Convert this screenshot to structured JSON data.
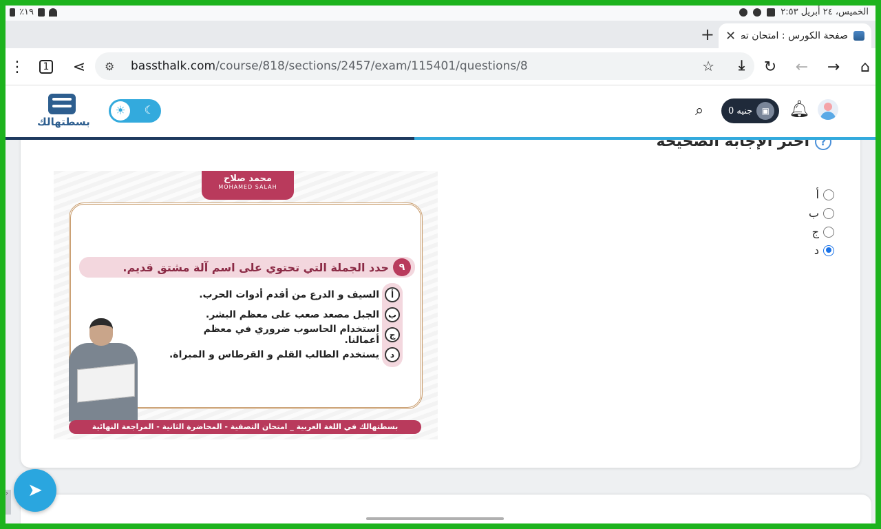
{
  "status_bar": {
    "left_text": "٪١٩",
    "right_text": "الخميس، ٢٤ أبريل  ٢:٥٣"
  },
  "tab": {
    "title": "صفحة الكورس : امتحان تصفية",
    "new_tab": "+",
    "close": "✕"
  },
  "address_bar": {
    "url_host": "bassthalk.com",
    "url_path": "/course/818/sections/2457/exam/115401/questions/8"
  },
  "site_header": {
    "logo_text": "بسطتهالك",
    "wallet_text": "0 جنيه",
    "progress": 0.47
  },
  "question": {
    "heading": "اختر الإجابة الصحيحة",
    "help": "?",
    "options": [
      {
        "label": "أ",
        "checked": false
      },
      {
        "label": "ب",
        "checked": false
      },
      {
        "label": "ج",
        "checked": false
      },
      {
        "label": "د",
        "checked": true
      }
    ]
  },
  "question_image": {
    "brand": "محمد صلاح",
    "brand_latin": "MOHAMED SALAH",
    "number": "٩",
    "text": "حدد الجملة التي تحتوي على اسم آلة مشتق قديم.",
    "choices": [
      {
        "letter": "أ",
        "text": "السيف و الدرع من أقدم أدوات الحرب."
      },
      {
        "letter": "ب",
        "text": "الجبل مصعد صعب على معظم البشر."
      },
      {
        "letter": "ج",
        "text": "استخدام الحاسوب ضروري في معظم أعمالنا."
      },
      {
        "letter": "د",
        "text": "يستخدم الطالب القلم و القرطاس و المبراة."
      }
    ],
    "footer": "بسطتهالك في اللغة العربية _ امتحان التصفية - المحاضرة الثانية - المراجعة النهائية"
  },
  "icons": {
    "telegram": "telegram-icon",
    "search": "search-icon",
    "bell": "bell-icon"
  },
  "colors": {
    "accent": "#33aadd",
    "brand": "#b93a5c",
    "radio_checked": "#1a73e8"
  }
}
